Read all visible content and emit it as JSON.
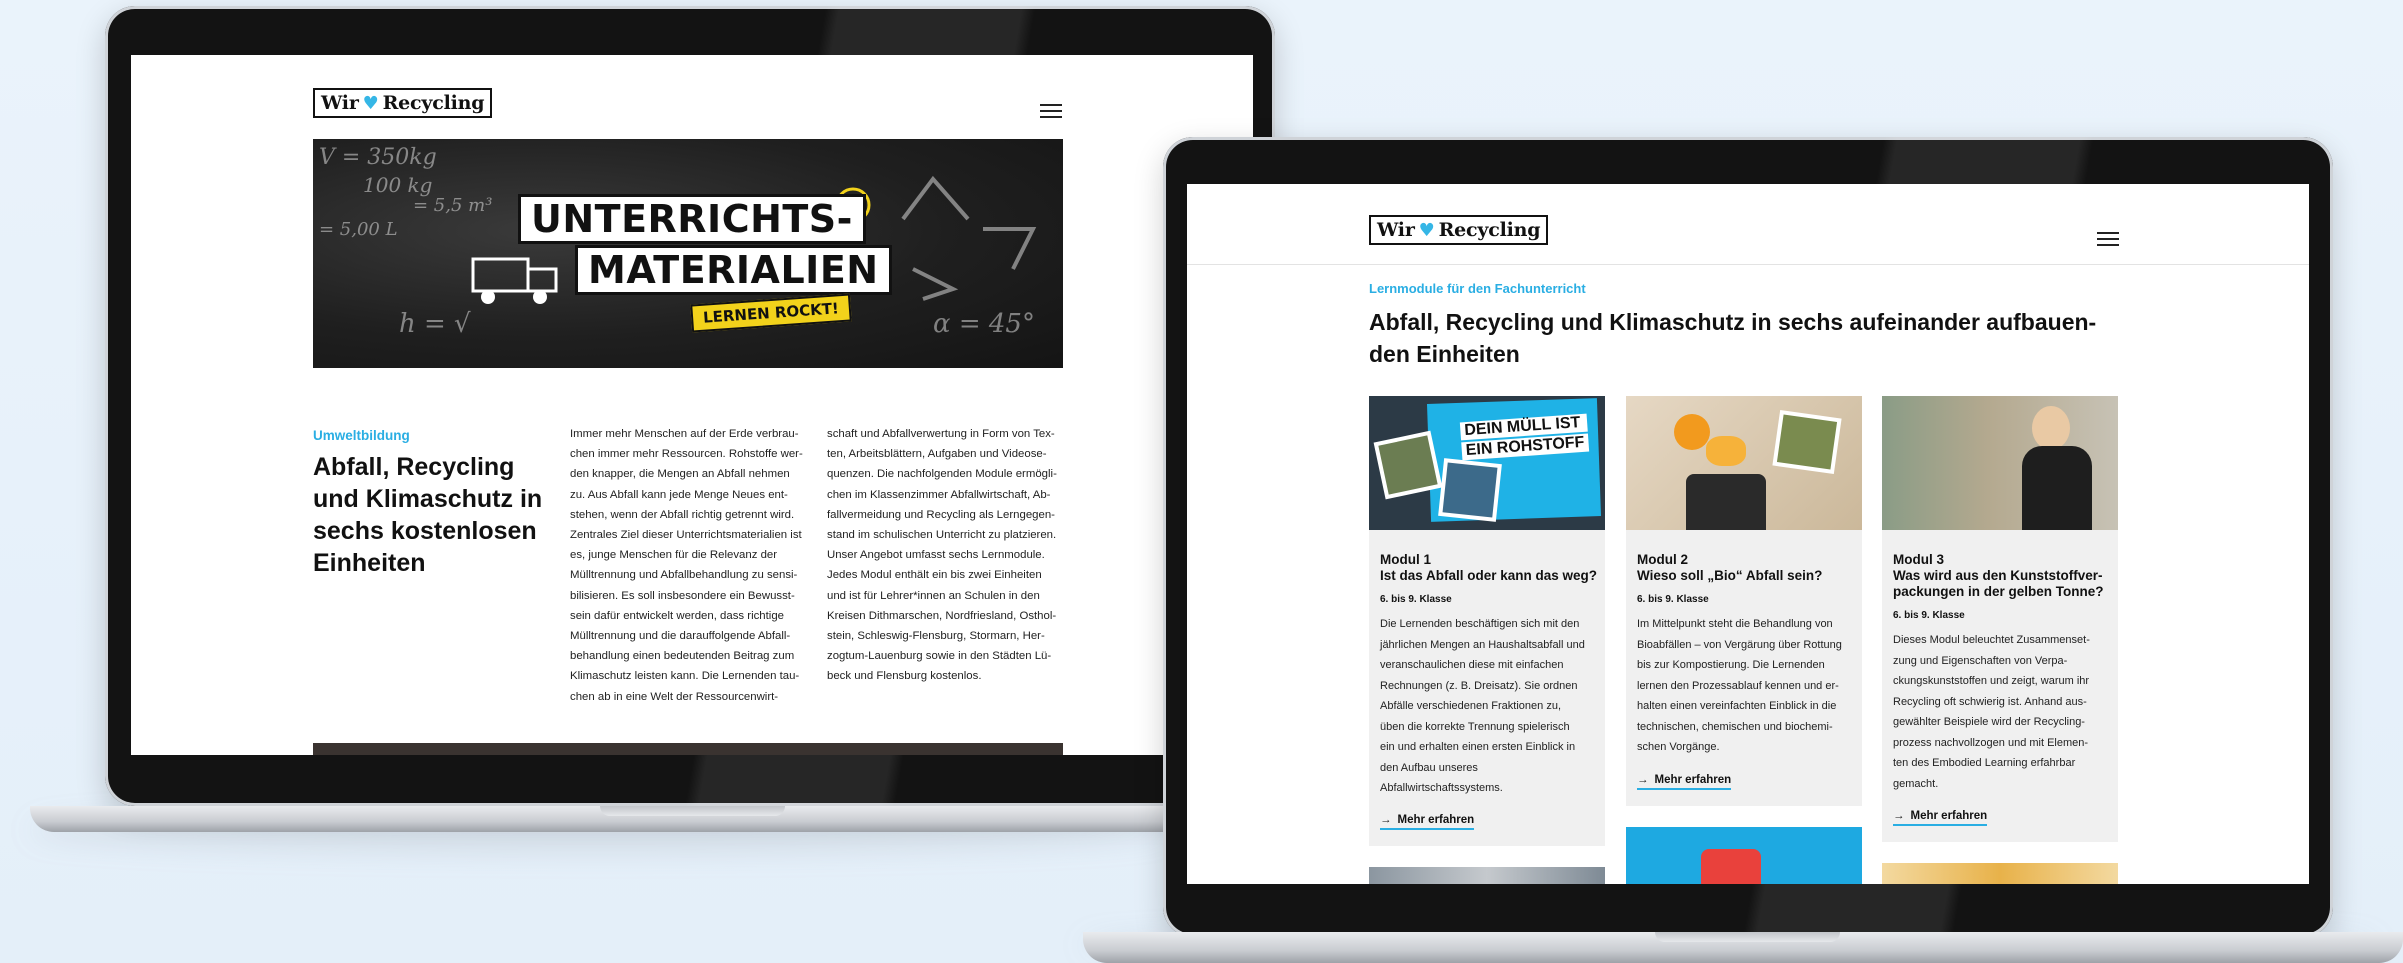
{
  "colors": {
    "accent": "#2aaee3",
    "hero_yellow": "#f2d21b",
    "card_bg": "#f0f0f0"
  },
  "site": {
    "logo_left": "Wir",
    "logo_heart": "♥",
    "logo_right": "Recycling",
    "menu_icon": "hamburger-icon"
  },
  "left_screen": {
    "hero": {
      "title_line1": "UNTERRICHTS-",
      "title_line2": "MATERIALIEN",
      "tag": "LERNEN ROCKT!",
      "chalk1": "V = 350kg",
      "chalk2": "100 kg",
      "chalk3": "= 5,5 m³",
      "chalk4": "= 5,00 L",
      "chalk5": "h = √",
      "chalk6": "α = 45°"
    },
    "kicker": "Umweltbildung",
    "headline": "Abfall, Recycling und Klimaschutz in sechs kostenlosen Einheiten",
    "col1": [
      "Immer mehr Menschen auf der Erde verbrau-",
      "chen immer mehr Ressourcen. Rohstoffe wer-",
      "den knapper, die Mengen an Abfall nehmen",
      "zu. Aus Abfall kann jede Menge Neues ent-",
      "stehen, wenn der Abfall richtig getrennt wird.",
      "Zentrales Ziel dieser Unterrichtsmaterialien ist",
      "es, junge Menschen für die Relevanz der",
      "Mülltrennung und Abfallbehandlung zu sensi-",
      "bilisieren. Es soll insbesondere ein Bewusst-",
      "sein dafür entwickelt werden, dass richtige",
      "Mülltrennung und die darauffolgende Abfall-",
      "behandlung einen bedeutenden Beitrag zum",
      "Klimaschutz leisten kann. Die Lernenden tau-",
      "chen ab in eine Welt der Ressourcenwirt-"
    ],
    "col2": [
      "schaft und Abfallverwertung in Form von Tex-",
      "ten, Arbeitsblättern, Aufgaben und Videose-",
      "quenzen. Die nachfolgenden Module ermögli-",
      "chen im Klassenzimmer Abfallwirtschaft, Ab-",
      "fallvermeidung und Recycling als Lerngegen-",
      "stand im schulischen Unterricht zu platzieren.",
      "Unser Angebot umfasst sechs Lernmodule.",
      "Jedes Modul enthält ein bis zwei Einheiten",
      "und ist für Lehrer*innen an Schulen in den",
      "Kreisen Dithmarschen, Nordfriesland, Osthol-",
      "stein, Schleswig-Flensburg, Stormarn, Her-",
      "zogtum-Lauenburg sowie in den Städten Lü-",
      "beck und Flensburg kostenlos."
    ]
  },
  "right_screen": {
    "kicker": "Lernmodule für den Fachunterricht",
    "headline_line1": "Abfall, Recycling und Klimaschutz in sechs aufeinander aufbauen-",
    "headline_line2": "den Einheiten",
    "cards": [
      {
        "module": "Modul 1",
        "title": "Ist das Abfall oder kann das weg?",
        "grade": "6. bis 9. Klasse",
        "img_text1": "DEIN MÜLL IST",
        "img_text2": "EIN ROHSTOFF",
        "desc": [
          "Die Lernenden beschäftigen sich mit den",
          "jährlichen Mengen an Haushaltsabfall und",
          "veranschaulichen diese mit einfachen",
          "Rechnungen (z. B. Dreisatz). Sie ordnen",
          "Abfälle verschiedenen Fraktionen zu,",
          "üben die korrekte Trennung spielerisch",
          "ein und erhalten einen ersten Einblick in",
          "den Aufbau unseres",
          "Abfallwirtschaftssystems."
        ],
        "more": "Mehr erfahren"
      },
      {
        "module": "Modul 2",
        "title": "Wieso soll „Bio“ Abfall sein?",
        "grade": "6. bis 9. Klasse",
        "desc": [
          "Im Mittelpunkt steht die Behandlung von",
          "Bioabfällen – von Vergärung über Rottung",
          "bis zur Kompostierung. Die Lernenden",
          "lernen den Prozessablauf kennen und er-",
          "halten einen vereinfachten Einblick in die",
          "technischen, chemischen und biochemi-",
          "schen Vorgänge."
        ],
        "more": "Mehr erfahren"
      },
      {
        "module": "Modul 3",
        "title_line1": "Was wird aus den Kunststoffver-",
        "title_line2": "packungen in der gelben Tonne?",
        "grade": "6. bis 9. Klasse",
        "desc": [
          "Dieses Modul beleuchtet Zusammenset-",
          "zung und Eigenschaften von Verpa-",
          "ckungskunststoffen und zeigt, warum ihr",
          "Recycling oft schwierig ist. Anhand aus-",
          "gewählter Beispiele wird der Recycling-",
          "prozess nachvollzogen und mit Elemen-",
          "ten des Embodied Learning erfahrbar",
          "gemacht."
        ],
        "more": "Mehr erfahren"
      }
    ]
  }
}
